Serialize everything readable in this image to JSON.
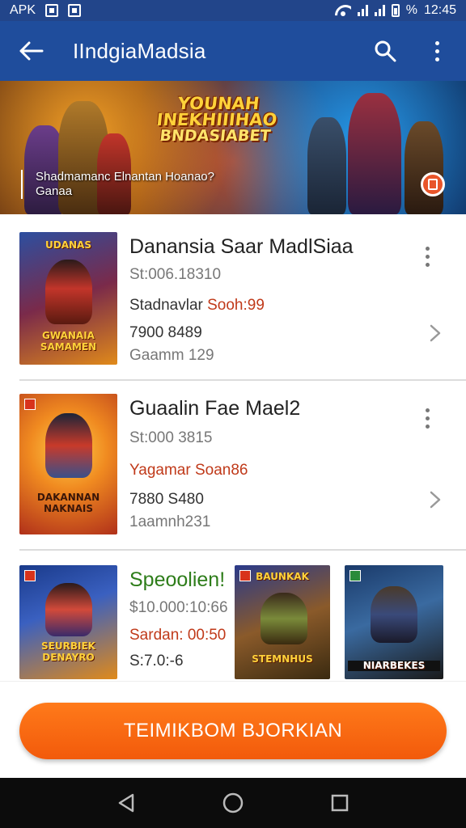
{
  "status_bar": {
    "carrier_label": "APK",
    "battery_text": "%",
    "time": "12:45"
  },
  "app_bar": {
    "title": "IIndgiaMadsia",
    "icons": [
      "back-arrow-icon",
      "search-icon",
      "more-vert-icon"
    ]
  },
  "banner": {
    "title_lines": [
      "YOUNAH",
      "INEKHIIIHAO",
      "BNDASIABET"
    ],
    "caption_line1": "Shadmamanc Elnantan  Hoanao?",
    "caption_line2": "Ganaa"
  },
  "list": {
    "items": [
      {
        "title": "Danansia Saar MadlSiaa",
        "subtitle": "St:006.18310",
        "meta_label": "Stadnavlar",
        "meta_value": "Sooh:99",
        "stat": "7900  8489",
        "footer": "Gaamm 129",
        "poster_text": [
          "UDANAS",
          "GWANAIA",
          "SAMAMEN"
        ]
      },
      {
        "title": "Guaalin Fae Mael2",
        "subtitle": "St:000 3815",
        "meta_label": "Yagamar",
        "meta_value": "Soan86",
        "stat": "7880  S480",
        "footer": "1aamnh231",
        "poster_text": [
          "DAKANNAN",
          "NAKNAIS"
        ]
      },
      {
        "title": "Speoolien!",
        "subtitle": "$10.000:10:66",
        "meta_label": "Sardan:",
        "meta_value": "00:50",
        "stat": "S:7.0:-6",
        "footer": "",
        "poster_text": [
          "SEURBIEK",
          "DENAYRO"
        ]
      }
    ],
    "extra_posters": [
      {
        "top_text": "BAUNKAK",
        "bottom_text": "STEMNHUS"
      },
      {
        "top_text": "",
        "bottom_text": "NIARBEKES"
      }
    ]
  },
  "cta": {
    "label": "TEIMIKBOM BJORKIAN"
  },
  "nav_bar": {
    "icons": [
      "back-triangle-icon",
      "home-circle-icon",
      "recents-square-icon"
    ]
  },
  "colors": {
    "app_bar": "#1f4d9c",
    "status_bar": "#22458a",
    "cta": "#f25a0b",
    "accent_text": "#c03a1a"
  }
}
